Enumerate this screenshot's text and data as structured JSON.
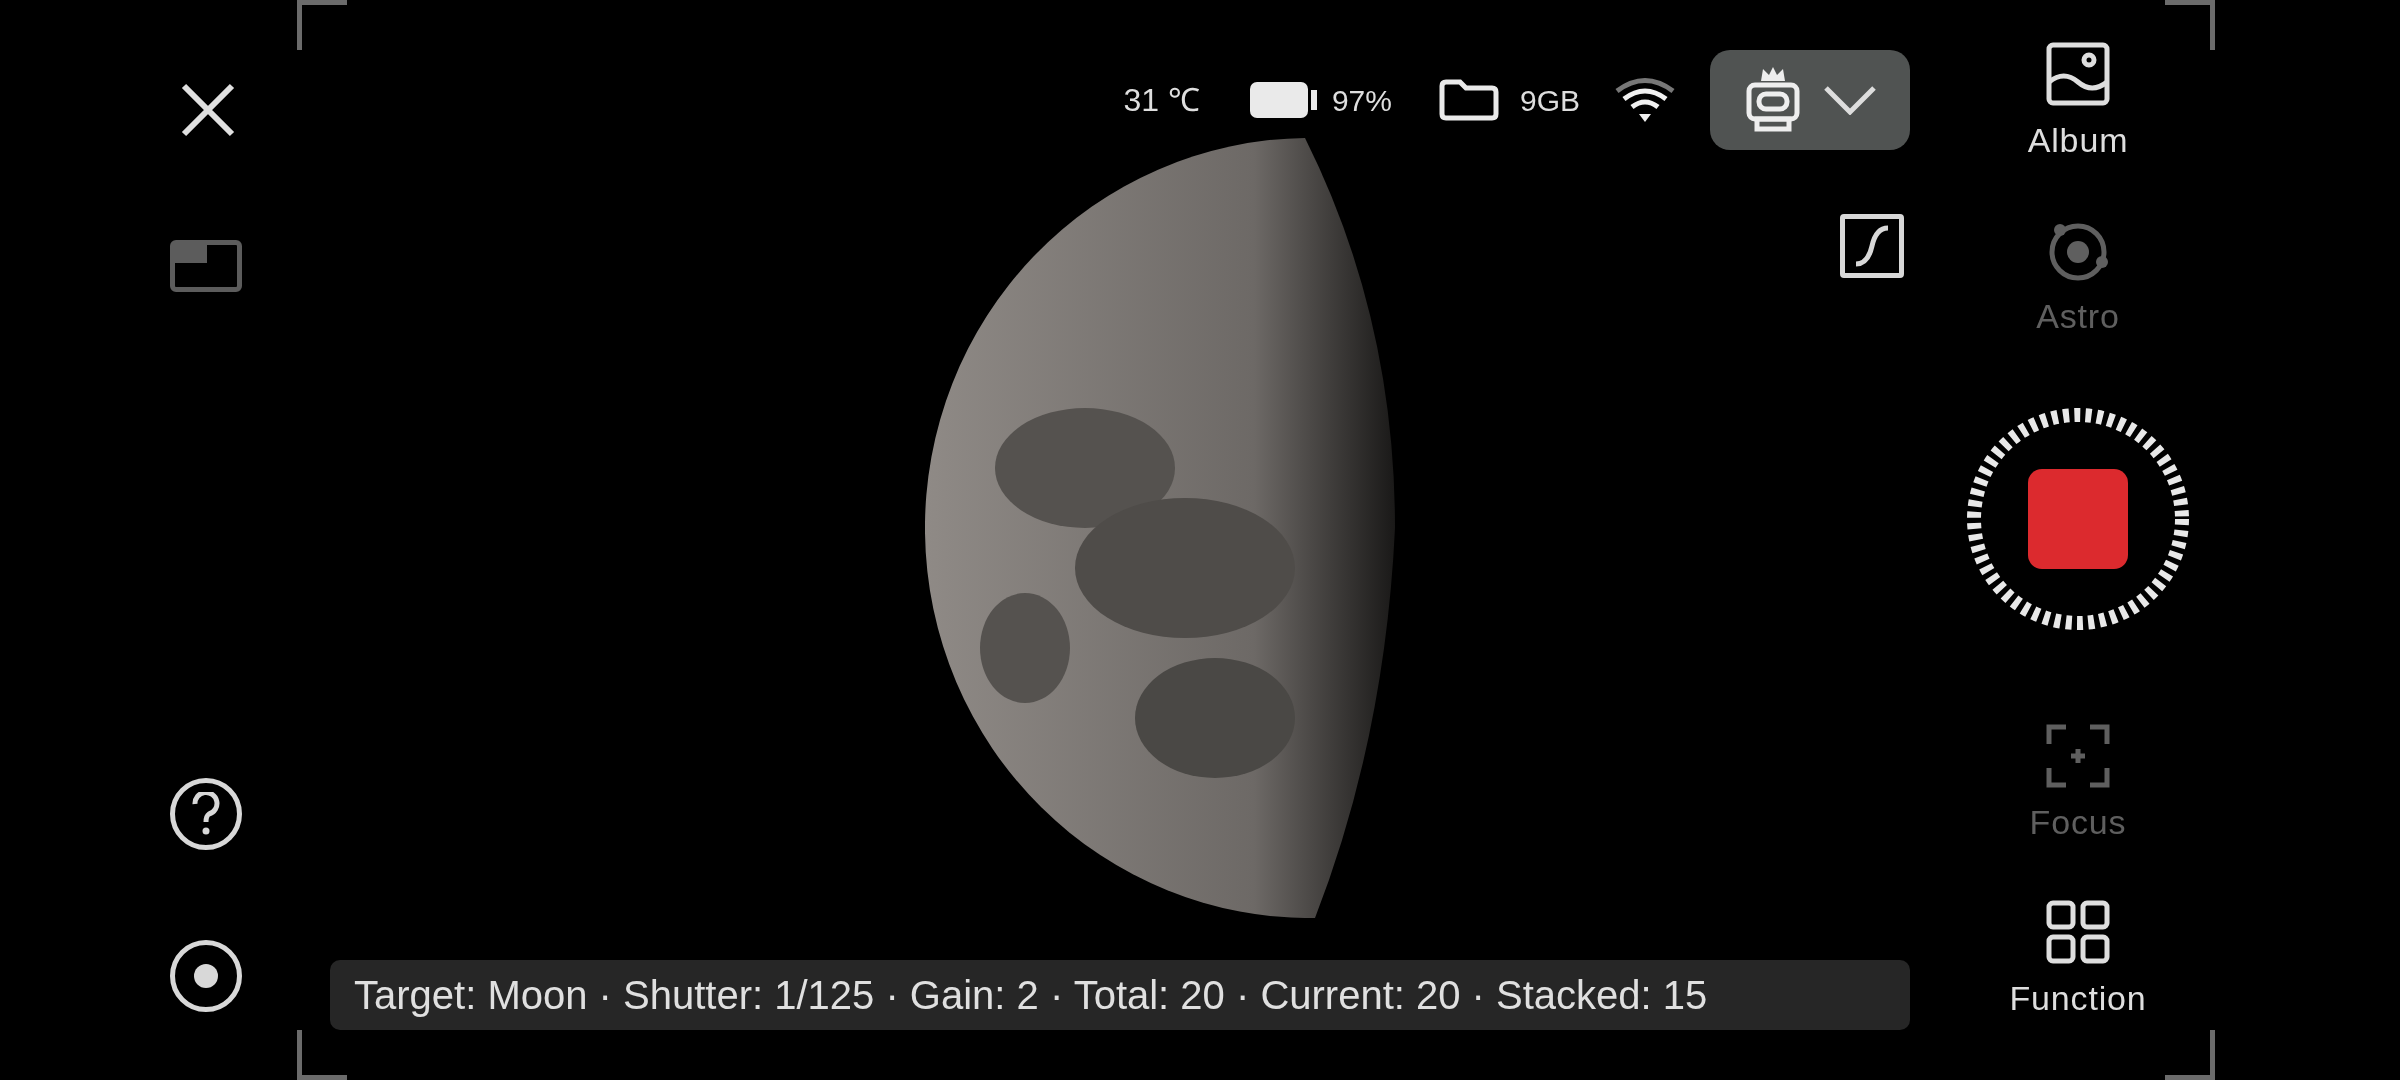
{
  "status": {
    "temperature": "31 ℃",
    "battery": "97%",
    "storage": "9GB"
  },
  "right_menu": [
    {
      "kind": "nav",
      "label": "Album",
      "disabled": false
    },
    {
      "kind": "nav",
      "label": "Astro",
      "disabled": true
    },
    {
      "kind": "record",
      "recording": true
    },
    {
      "kind": "nav",
      "label": "Focus",
      "disabled": true
    },
    {
      "kind": "nav",
      "label": "Function",
      "disabled": false
    }
  ],
  "info_bar": "Target: Moon · Shutter: 1/125 · Gain: 2 · Total: 20 · Current: 20 · Stacked: 15"
}
